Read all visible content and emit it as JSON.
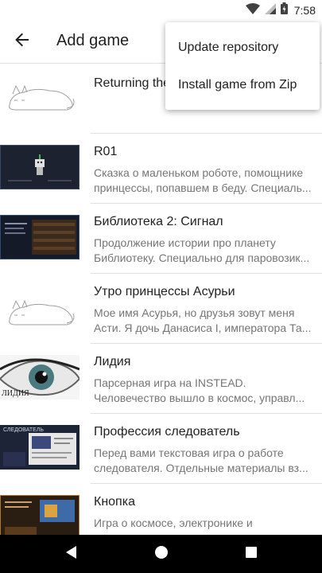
{
  "status_bar": {
    "time": "7:58",
    "icons": [
      "wifi-icon",
      "signal-icon",
      "battery-icon"
    ]
  },
  "app_bar": {
    "title": "Add game",
    "back_icon": "arrow-back-icon"
  },
  "overflow_menu": {
    "items": [
      {
        "label": "Update repository"
      },
      {
        "label": "Install game from Zip"
      }
    ]
  },
  "games": [
    {
      "title": "Returning the Quantum Cat",
      "description": "",
      "thumbnail": "sleeping-cat"
    },
    {
      "title": "R01",
      "description": "Сказка о маленьком роботе, помощнике принцессы, попавшем в беду. Специаль...",
      "thumbnail": "robot-screen"
    },
    {
      "title": "Библиотека 2: Сигнал",
      "description": "Продолжение истории про планету Библиотеку. Специально для паровозик...",
      "thumbnail": "library-screen"
    },
    {
      "title": "Утро принцессы Асурьи",
      "description": "Мое имя Асурья, но друзья зовут меня Асти. Я дочь Данасиса I, императора Та...",
      "thumbnail": "sleeping-cat"
    },
    {
      "title": "Лидия",
      "description": "Парсерная игра на INSTEAD. Человечество вышло в космос, управл...",
      "thumbnail": "eye-image",
      "thumbnail_caption": "лидия"
    },
    {
      "title": "Профессия следователь",
      "description": "Перед вами текстовая игра о работе следователя. Отдельные материалы вз...",
      "thumbnail": "detective-screen",
      "thumbnail_caption": "следователь"
    },
    {
      "title": "Кнопка",
      "description": "Игра о космосе, электронике и приключениях.",
      "thumbnail": "button-screen"
    }
  ],
  "nav_bar": {
    "icons": [
      "back-triangle-icon",
      "home-circle-icon",
      "recents-square-icon"
    ]
  },
  "colors": {
    "divider": "#e0e0e0",
    "primary_text": "#212121",
    "secondary_text": "#757575",
    "nav_bar": "#000000"
  }
}
